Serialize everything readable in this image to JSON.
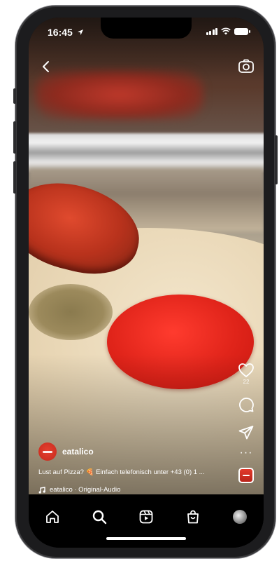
{
  "status_bar": {
    "time": "16:45",
    "location_icon": "location-arrow-icon",
    "signal_icon": "cellular-signal-icon",
    "wifi_icon": "wifi-icon",
    "battery_icon": "battery-icon"
  },
  "top_controls": {
    "back_icon": "chevron-left-icon",
    "camera_icon": "camera-icon"
  },
  "actions": {
    "like_icon": "heart-icon",
    "like_count": "22",
    "comment_icon": "comment-icon",
    "share_icon": "paper-plane-icon",
    "more_label": "···"
  },
  "post": {
    "author": "eatalico",
    "caption": "Lust auf Pizza? 🍕 Einfach telefonisch unter +43 (0) 1 ...",
    "audio_label": "eatalico · Original-Audio",
    "audio_icon": "music-note-icon"
  },
  "bottom_nav": {
    "items": [
      "home-icon",
      "search-icon",
      "reels-icon",
      "shop-icon",
      "profile-avatar"
    ]
  },
  "colors": {
    "sauce": "#e0241a",
    "brand_red": "#c62a1c",
    "nav_bg": "#000000",
    "text": "#ffffff"
  }
}
